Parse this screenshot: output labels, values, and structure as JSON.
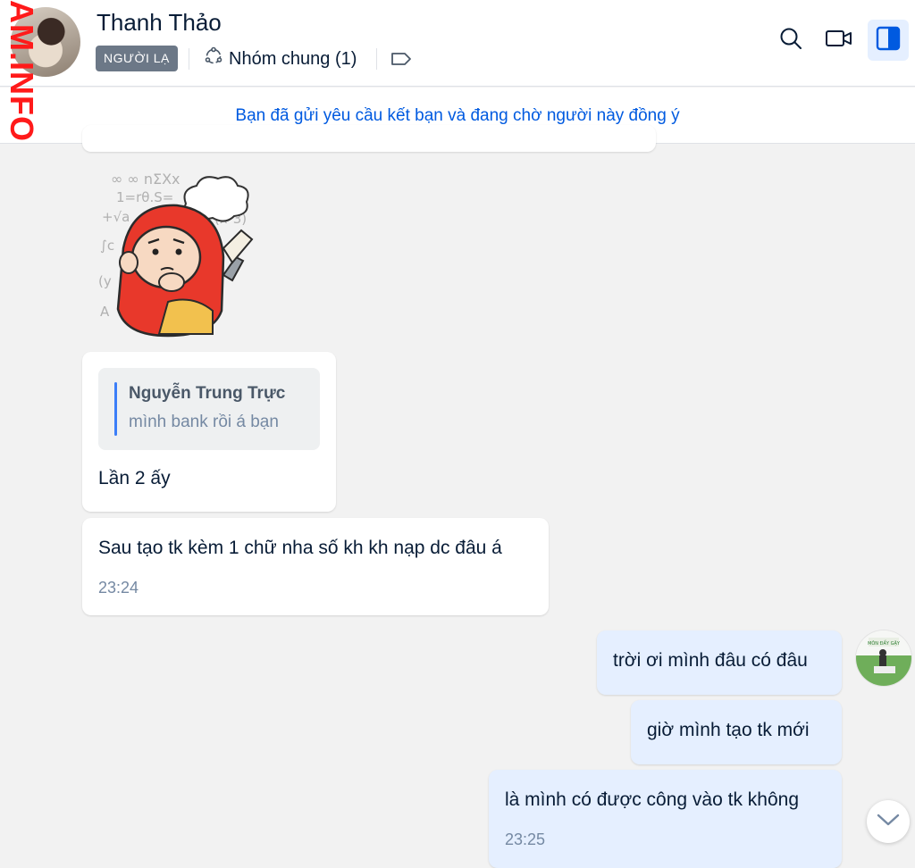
{
  "watermark": "AM.INFO",
  "header": {
    "contact_name": "Thanh Thảo",
    "stranger_badge": "NGƯỜI LẠ",
    "common_groups": "Nhóm chung (1)",
    "icons": [
      "group-icon",
      "tag-icon",
      "search-icon",
      "video-call-icon",
      "sidebar-toggle-icon"
    ],
    "accent_color": "#005ae0"
  },
  "notice": {
    "text": "Bạn đã gửi yêu cầu kết bạn và đang chờ người này đồng ý"
  },
  "messages": {
    "sticker": {
      "icon": "thinking-monkey-sticker"
    },
    "reply": {
      "quote_author": "Nguyễn Trung Trực",
      "quote_text": "mình bank rồi á bạn",
      "text": "Lần 2 ấy"
    },
    "incoming_last": {
      "text": "Sau tạo tk kèm 1 chữ nha số kh kh nạp dc đâu á",
      "time": "23:24"
    },
    "outgoing": [
      {
        "text": "trời ơi mình đâu có đâu"
      },
      {
        "text": "giờ mình tạo tk mới"
      },
      {
        "text": "là mình có được công vào tk không",
        "time": "23:25"
      }
    ]
  },
  "colors": {
    "outgoing_bubble": "#e5efff",
    "incoming_bubble": "#ffffff",
    "badge_bg": "#6c7887"
  }
}
